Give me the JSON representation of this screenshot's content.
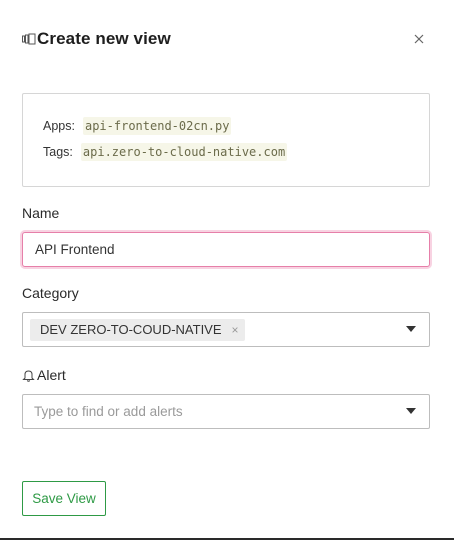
{
  "dialog": {
    "title": "Create new view",
    "title_icon": "view-panels-icon",
    "close_icon": "close-icon",
    "close_symbol": "×"
  },
  "info": {
    "apps_label": "Apps:",
    "apps_value": "api-frontend-02cn.py",
    "tags_label": "Tags:",
    "tags_value": "api.zero-to-cloud-native.com"
  },
  "name_field": {
    "label": "Name",
    "value": "API Frontend"
  },
  "category_field": {
    "label": "Category",
    "selected": [
      "DEV ZERO-TO-COUD-NATIVE"
    ],
    "chip_remove_symbol": "×"
  },
  "alert_field": {
    "label": "Alert",
    "icon": "bell-icon",
    "placeholder": "Type to find or add alerts"
  },
  "actions": {
    "save_label": "Save View"
  },
  "colors": {
    "accent_green": "#2e9a45",
    "focus_pink": "#e67fa9",
    "code_bg": "#f6f6e8"
  }
}
